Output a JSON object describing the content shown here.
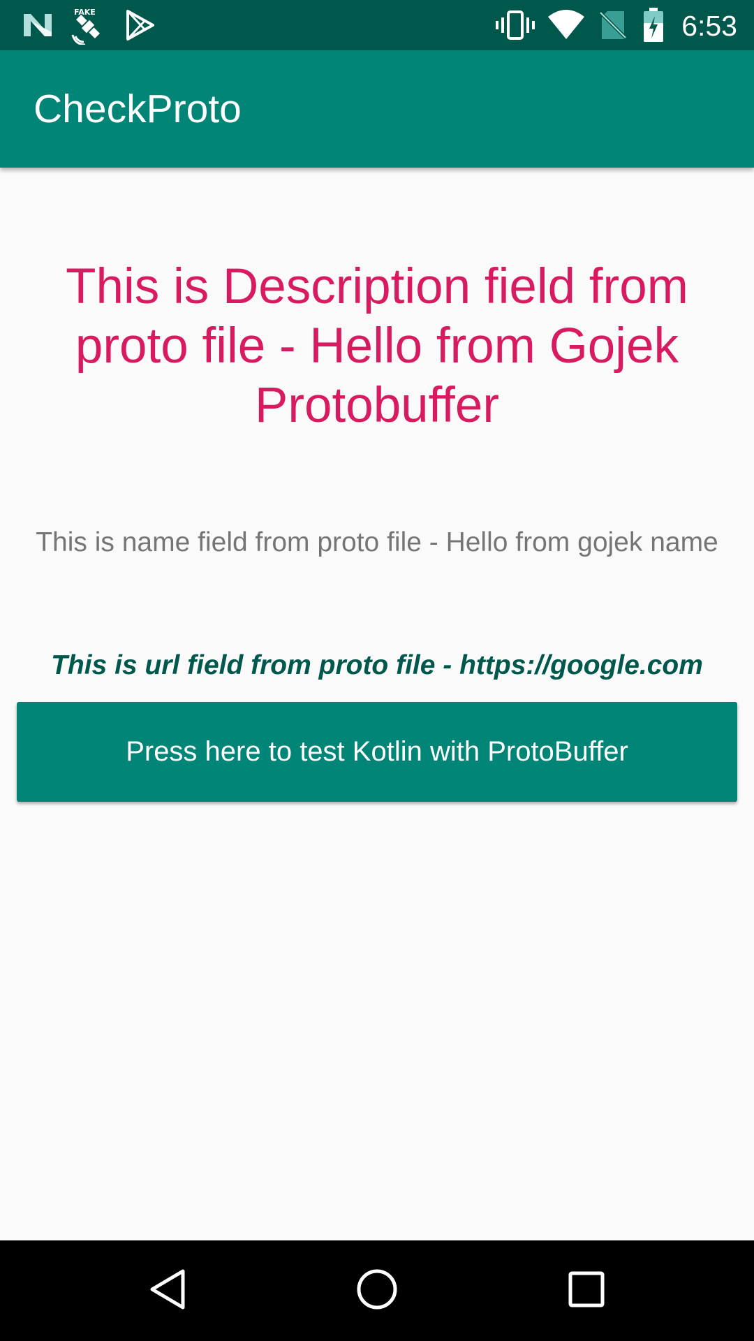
{
  "status_bar": {
    "time": "6:53",
    "left_icons": [
      "notification-n-icon",
      "fake-gps-satellite-icon",
      "play-store-icon"
    ],
    "right_icons": [
      "vibrate-icon",
      "wifi-icon",
      "no-sim-icon",
      "battery-charging-icon"
    ],
    "fake_badge": "FAKE",
    "background_color": "#00574B"
  },
  "app_bar": {
    "title": "CheckProto",
    "background_color": "#008577"
  },
  "content": {
    "description": "This is Description field from proto file - Hello from Gojek Protobuffer",
    "description_color": "#D81B60",
    "name": "This is name field from proto file - Hello from gojek name",
    "name_color": "#757575",
    "url": "This is url field from proto file - https://google.com",
    "url_color": "#00574B"
  },
  "button": {
    "label": "Press here to test Kotlin with ProtoBuffer",
    "background_color": "#008577"
  },
  "nav_bar": {
    "icons": [
      "back-icon",
      "home-icon",
      "recents-icon"
    ]
  }
}
